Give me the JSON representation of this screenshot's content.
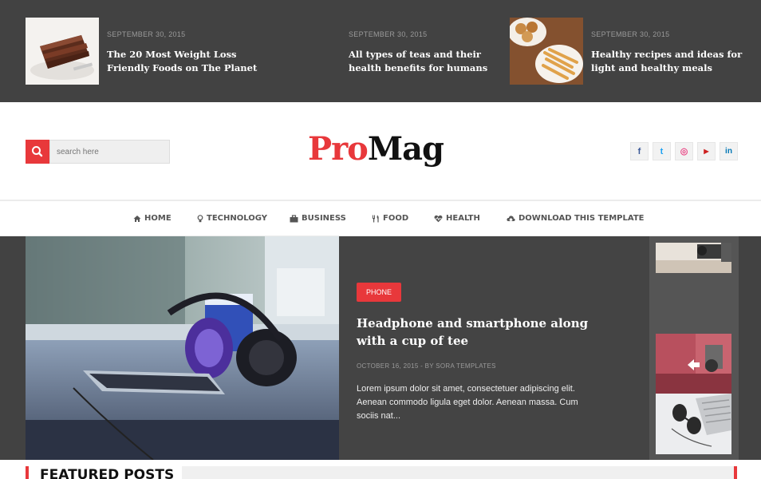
{
  "top_posts": [
    {
      "date": "SEPTEMBER 30, 2015",
      "title": "The 20 Most Weight Loss Friendly Foods on The Planet"
    },
    {
      "date": "SEPTEMBER 30, 2015",
      "title": "All types of teas and their health benefits for humans"
    },
    {
      "date": "SEPTEMBER 30, 2015",
      "title": "Healthy recipes and ideas for light and healthy meals"
    }
  ],
  "search": {
    "placeholder": "search here"
  },
  "logo": {
    "part1": "Pro",
    "part2": "Mag"
  },
  "social": [
    {
      "icon": "facebook-icon",
      "glyph": "f",
      "color": "#3b5998"
    },
    {
      "icon": "twitter-icon",
      "glyph": "t",
      "color": "#1da1f2"
    },
    {
      "icon": "dribbble-icon",
      "glyph": "◎",
      "color": "#ea4c89"
    },
    {
      "icon": "youtube-icon",
      "glyph": "▶",
      "color": "#cd201f"
    },
    {
      "icon": "linkedin-icon",
      "glyph": "in",
      "color": "#0077b5"
    }
  ],
  "nav": [
    {
      "label": "HOME",
      "icon": "home-icon"
    },
    {
      "label": "TECHNOLOGY",
      "icon": "lightbulb-icon"
    },
    {
      "label": "BUSINESS",
      "icon": "briefcase-icon"
    },
    {
      "label": "FOOD",
      "icon": "cutlery-icon"
    },
    {
      "label": "HEALTH",
      "icon": "heartbeat-icon"
    },
    {
      "label": "DOWNLOAD THIS TEMPLATE",
      "icon": "cloud-download-icon"
    }
  ],
  "slide": {
    "tag": "PHONE",
    "title": "Headphone and smartphone along with a cup of tee",
    "meta": "OCTOBER 16, 2015 - BY SORA TEMPLATES",
    "excerpt": "Lorem ipsum dolor sit amet, consectetuer adipiscing elit. Aenean commodo ligula eget dolor. Aenean massa. Cum sociis nat..."
  },
  "featured": {
    "title": "FEATURED POSTS"
  },
  "colors": {
    "accent": "#e8383b",
    "dark_bg": "#424242"
  }
}
